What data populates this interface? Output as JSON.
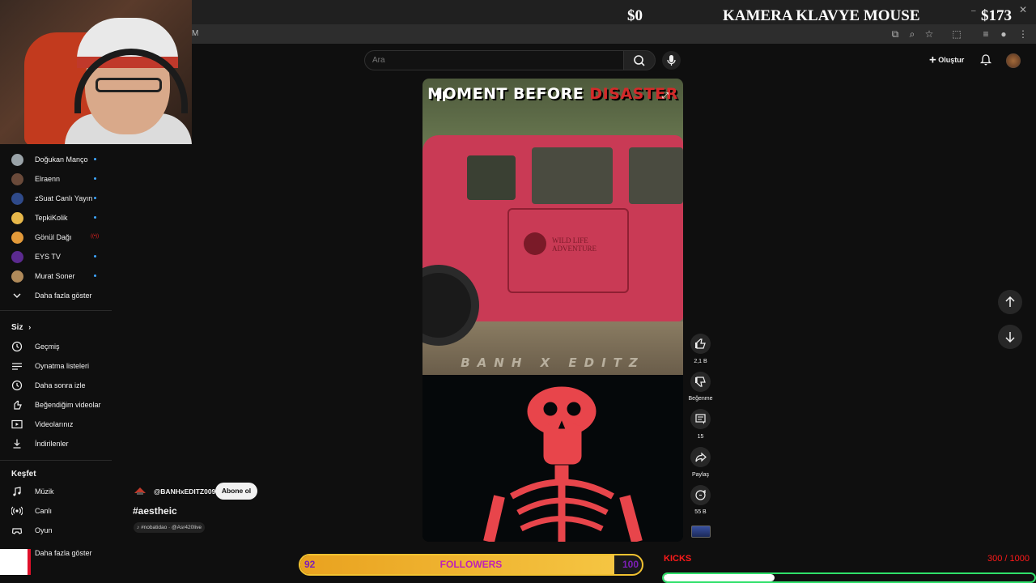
{
  "overlay": {
    "money_left": "$0",
    "goal_title": "KAMERA KLAVYE MOUSE",
    "money_right": "$173",
    "url_fragment": "M"
  },
  "header": {
    "search_placeholder": "Ara",
    "create_label": "Oluştur"
  },
  "subscriptions": [
    {
      "name": "Doğukan Manço",
      "color": "#9aa3a8",
      "indicator": "dot"
    },
    {
      "name": "Elraenn",
      "color": "#6a4a3a",
      "indicator": "dot"
    },
    {
      "name": "zSuat Canlı Yayın",
      "color": "#2f4a8a",
      "indicator": "dot"
    },
    {
      "name": "TepkiKolik",
      "color": "#e8b84a",
      "indicator": "dot"
    },
    {
      "name": "Gönül Dağı",
      "color": "#e39a3a",
      "indicator": "live"
    },
    {
      "name": "EYS TV",
      "color": "#5b2a8f",
      "indicator": "dot"
    },
    {
      "name": "Murat Soner",
      "color": "#b08a5a",
      "indicator": "dot"
    }
  ],
  "sidebar": {
    "show_more": "Daha fazla göster",
    "you_title": "Siz",
    "you_items": [
      {
        "label": "Geçmiş",
        "icon": "history-icon"
      },
      {
        "label": "Oynatma listeleri",
        "icon": "playlists-icon"
      },
      {
        "label": "Daha sonra izle",
        "icon": "watch-later-icon"
      },
      {
        "label": "Beğendiğim videolar",
        "icon": "like-icon"
      },
      {
        "label": "Videolarınız",
        "icon": "your-videos-icon"
      },
      {
        "label": "İndirilenler",
        "icon": "download-icon"
      }
    ],
    "explore_title": "Keşfet",
    "explore_items": [
      {
        "label": "Müzik",
        "icon": "music-icon"
      },
      {
        "label": "Canlı",
        "icon": "live-icon"
      },
      {
        "label": "Oyun",
        "icon": "gaming-icon"
      }
    ],
    "explore_more": "Daha fazla göster"
  },
  "short": {
    "title_part1": "MOMENT BEFORE ",
    "title_part2": "DISASTER",
    "credit": "BANH X EDITZ",
    "vehicle_text": "WILD LIFE ADVENTURE",
    "channel": "@BANHxEDITZ009",
    "subscribe_label": "Abone ol",
    "hashtag": "#aestheic",
    "sound": "#nobatidao · @Asr420live"
  },
  "actions": {
    "likes": "2,1 B",
    "dislike_label": "Beğenme",
    "comments": "15",
    "share_label": "Paylaş",
    "remix_count": "55 B"
  },
  "followers_goal": {
    "current": "92",
    "label": "FOLLOWERS",
    "target": "100",
    "progress": 0.92
  },
  "kicks_goal": {
    "label": "KICKS",
    "count_text": "300 / 1000",
    "progress": 0.3
  },
  "colors": {
    "accent_blue": "#3ea6ff",
    "goal_gold": "#f2c230",
    "kicks_green": "#2fe06a",
    "alert_red": "#ff1a1a"
  }
}
